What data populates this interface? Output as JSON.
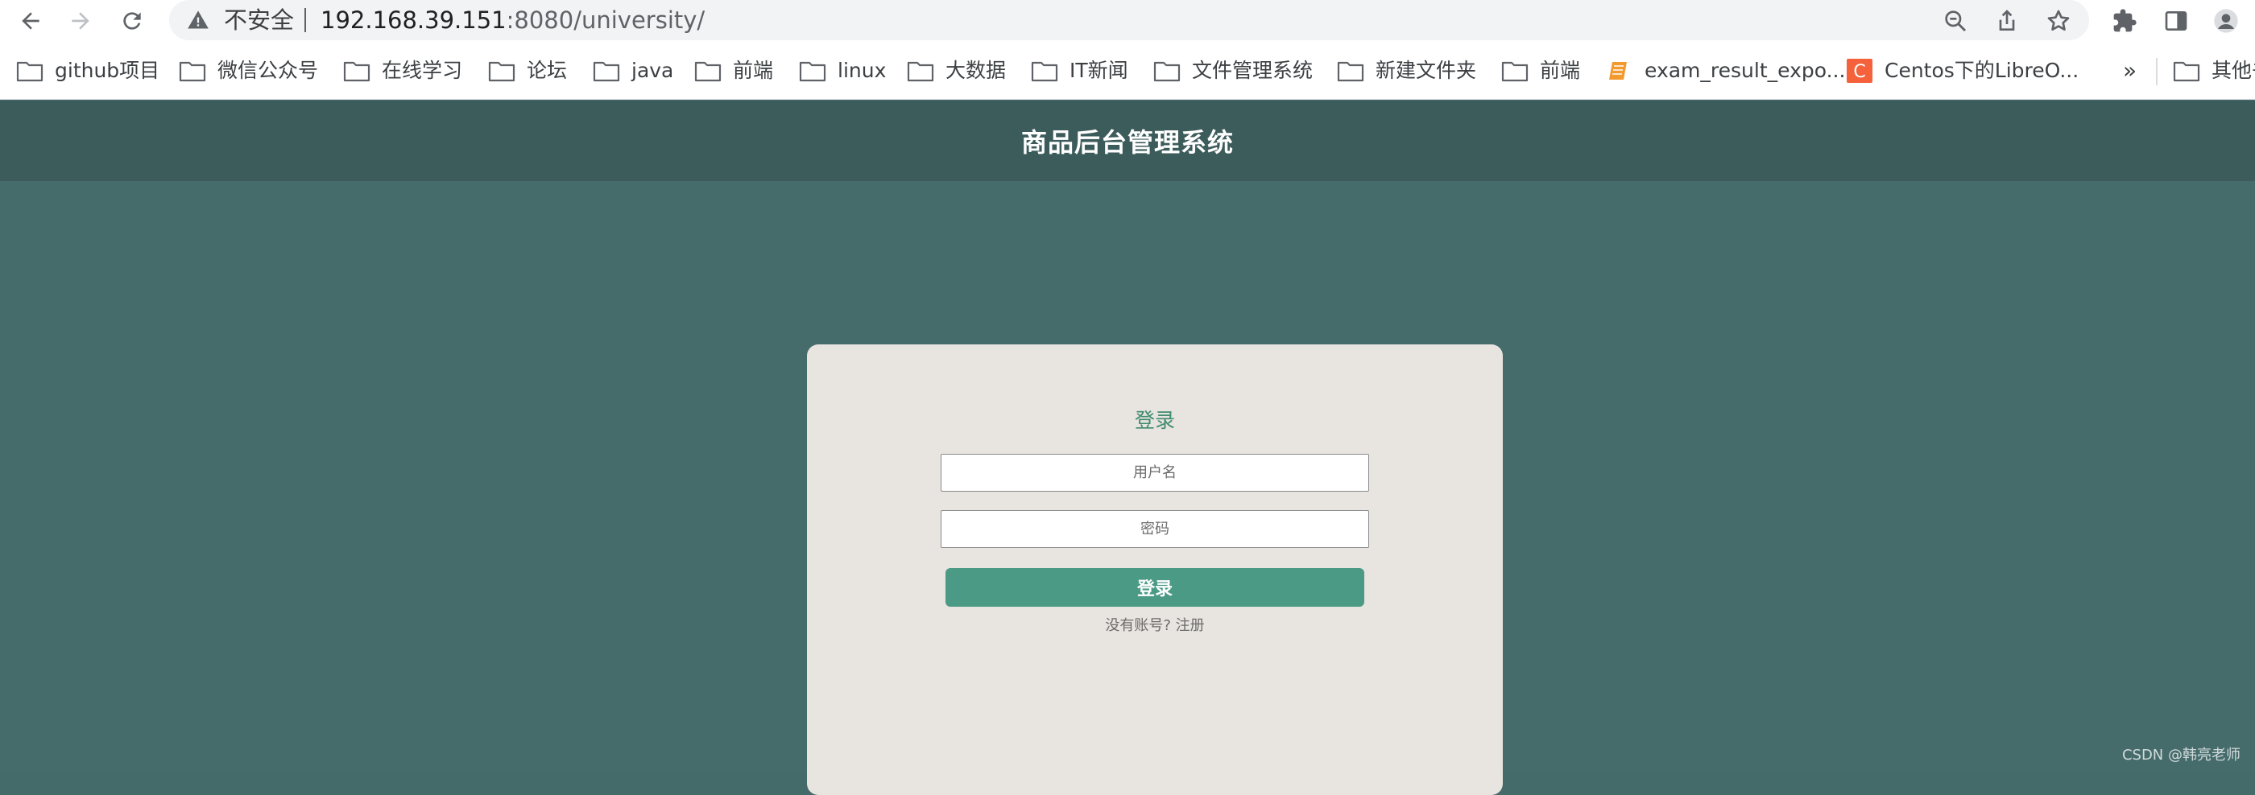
{
  "browser": {
    "security_label": "不安全",
    "url_host": "192.168.39.151",
    "url_path": ":8080/university/",
    "icons": [
      "back-arrow-icon",
      "forward-arrow-icon",
      "reload-icon",
      "warning-icon",
      "zoom-icon",
      "share-icon",
      "star-icon",
      "extensions-icon",
      "side-panel-icon",
      "profile-icon"
    ]
  },
  "bookmarks": {
    "items": [
      {
        "label": "github项目",
        "icon": "folder-icon"
      },
      {
        "label": "微信公众号",
        "icon": "folder-icon"
      },
      {
        "label": "在线学习",
        "icon": "folder-icon"
      },
      {
        "label": "论坛",
        "icon": "folder-icon"
      },
      {
        "label": "java",
        "icon": "folder-icon"
      },
      {
        "label": "前端",
        "icon": "folder-icon"
      },
      {
        "label": "linux",
        "icon": "folder-icon"
      },
      {
        "label": "大数据",
        "icon": "folder-icon"
      },
      {
        "label": "IT新闻",
        "icon": "folder-icon"
      },
      {
        "label": "文件管理系统",
        "icon": "folder-icon"
      },
      {
        "label": "新建文件夹",
        "icon": "folder-icon"
      },
      {
        "label": "前端",
        "icon": "folder-icon"
      },
      {
        "label": "exam_result_expo...",
        "icon": "book-icon"
      },
      {
        "label": "Centos下的LibreO...",
        "icon": "csdn-c-icon"
      }
    ],
    "more": "»",
    "other": "其他书"
  },
  "app": {
    "title": "商品后台管理系统"
  },
  "login": {
    "title": "登录",
    "username_placeholder": "用户名",
    "password_placeholder": "密码",
    "submit_label": "登录",
    "no_account": "没有账号?",
    "register_link": "注册"
  },
  "watermark": "CSDN @韩亮老师",
  "colors": {
    "header_bg": "#3c5b5b",
    "page_bg": "#466b6b",
    "card_bg": "#e8e4df",
    "accent": "#4b9a86",
    "title_green": "#3f8c70"
  }
}
